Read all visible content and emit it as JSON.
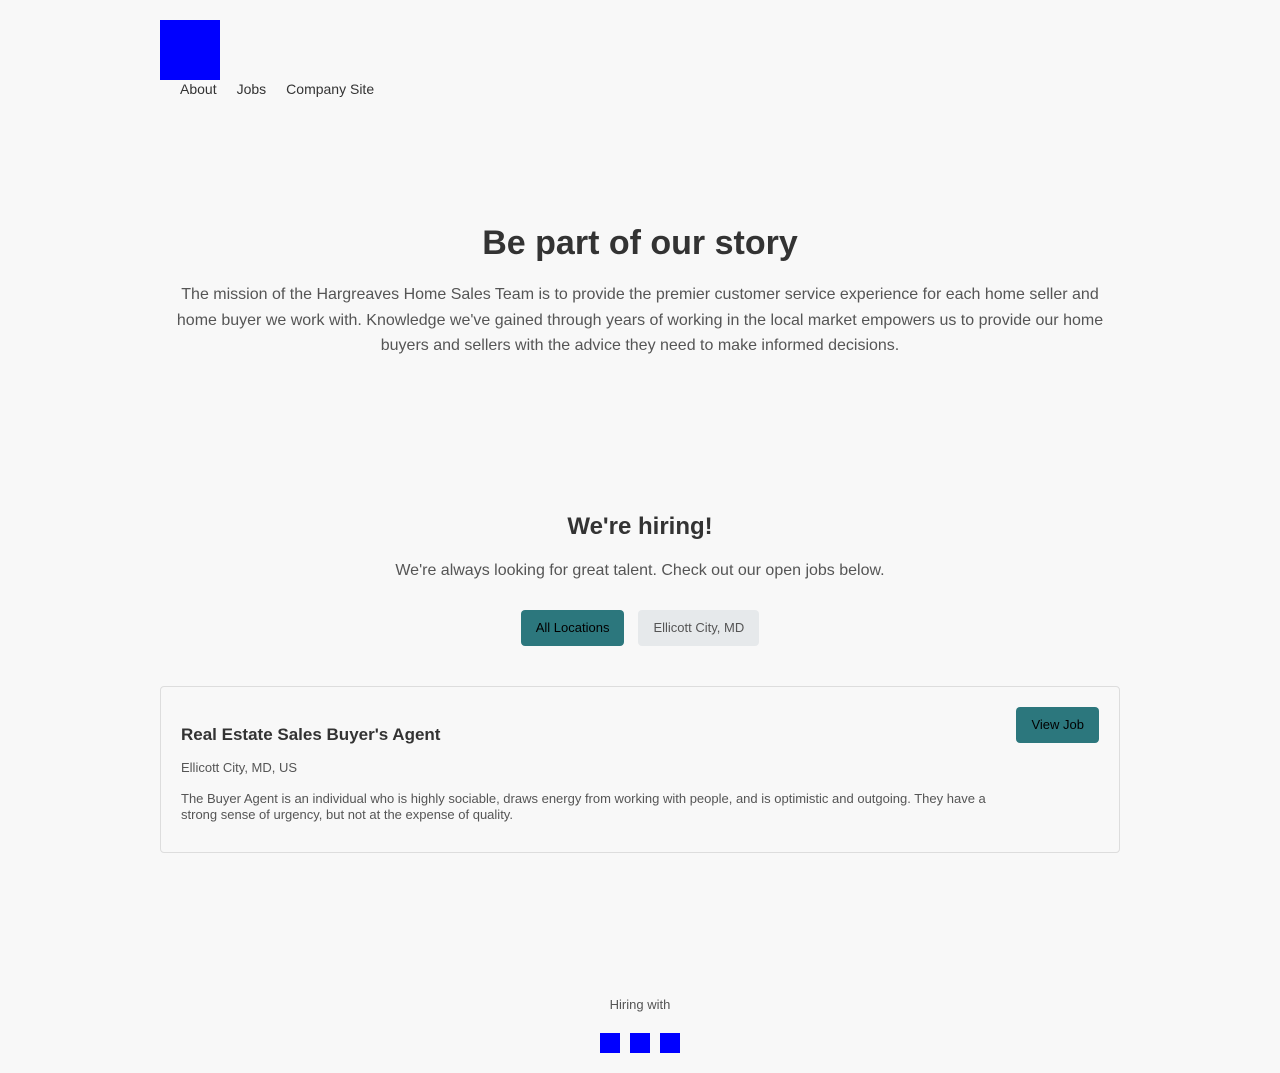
{
  "header": {
    "logo_icon": "company-logo",
    "nav": [
      "About",
      "Jobs",
      "Company Site"
    ]
  },
  "hero": {
    "title": "Be part of our story",
    "text": "The mission of the Hargreaves Home Sales Team is to provide the premier customer service experience for each home seller and home buyer we work with. Knowledge we've gained through years of working in the local market empowers us to provide our home buyers and sellers with the advice they need to make informed decisions."
  },
  "hiring": {
    "title": "We're hiring!",
    "subtitle": "We're always looking for great talent. Check out our open jobs below.",
    "filters": [
      "All Locations",
      "Ellicott City, MD"
    ],
    "active_filter": "All Locations"
  },
  "jobs": [
    {
      "title": "Real Estate Sales Buyer's Agent",
      "location": "Ellicott City, MD, US",
      "description": "The Buyer Agent is an individual who is highly sociable, draws energy from working with people, and is optimistic and outgoing. They have a strong sense of urgency, but not at the expense of quality.",
      "button": "View Job"
    }
  ],
  "footer": {
    "text": "Hiring with",
    "social_icons": [
      "social-icon-1",
      "social-icon-2",
      "social-icon-3"
    ]
  },
  "colors": {
    "background": "#f8f8f8",
    "accent": "#2c777d",
    "logo_placeholder": "#0000ff",
    "inactive_filter": "#e6e9eb"
  }
}
